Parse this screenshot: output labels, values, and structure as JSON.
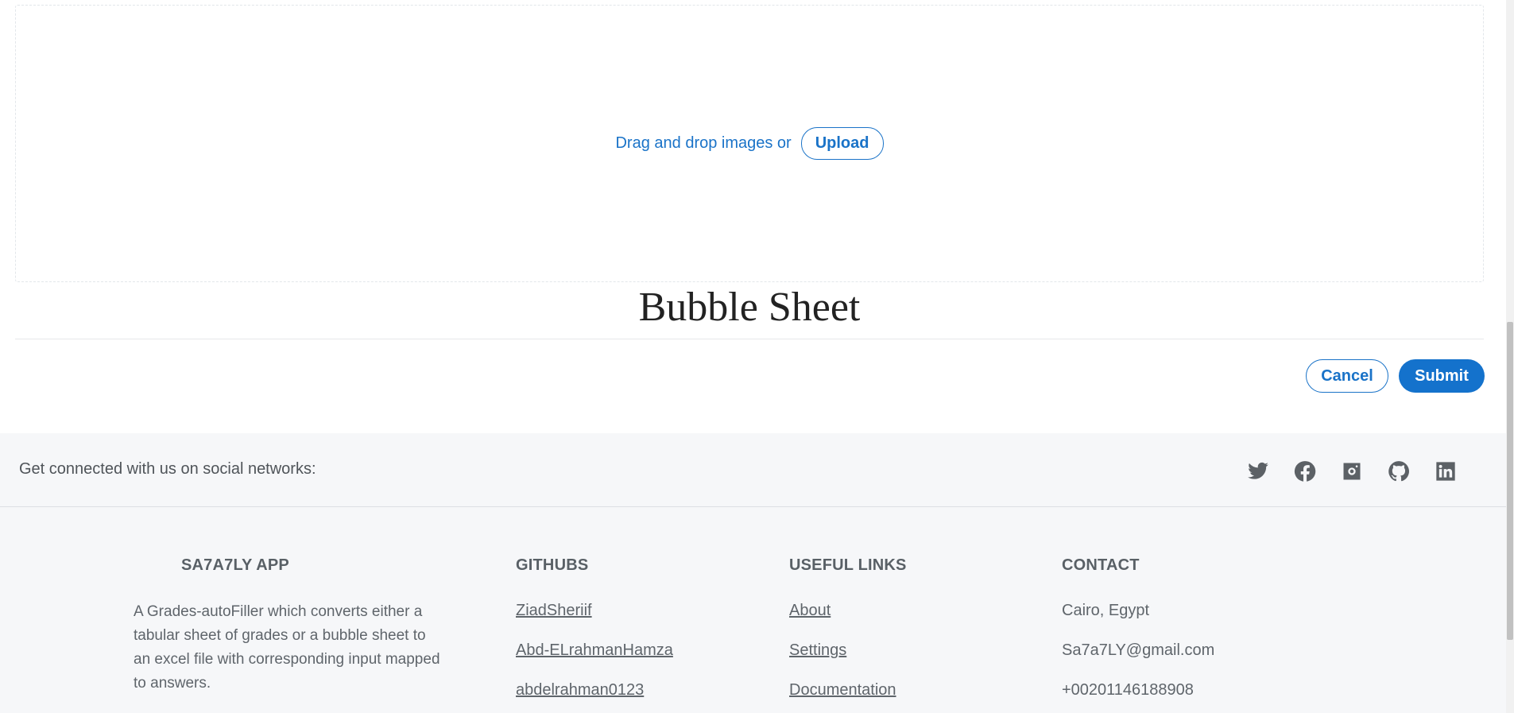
{
  "dropzone": {
    "text": "Drag and drop images or",
    "upload_label": "Upload"
  },
  "sheet": {
    "title": "Bubble Sheet"
  },
  "actions": {
    "cancel_label": "Cancel",
    "submit_label": "Submit"
  },
  "footer": {
    "social_text": "Get connected with us on social networks:",
    "social_icons": [
      "twitter-icon",
      "facebook-icon",
      "instagram-icon",
      "github-icon",
      "linkedin-icon"
    ],
    "app": {
      "heading": "SA7A7LY APP",
      "description": "A Grades-autoFiller which converts either a tabular sheet of grades or a bubble sheet to an excel file with corresponding input mapped to answers."
    },
    "githubs": {
      "heading": "GITHUBS",
      "links": [
        "ZiadSheriif",
        "Abd-ELrahmanHamza",
        "abdelrahman0123"
      ]
    },
    "useful_links": {
      "heading": "USEFUL LINKS",
      "links": [
        "About",
        "Settings",
        "Documentation"
      ]
    },
    "contact": {
      "heading": "CONTACT",
      "items": [
        "Cairo, Egypt",
        "Sa7a7LY@gmail.com",
        "+00201146188908"
      ]
    }
  },
  "colors": {
    "accent": "#1a73c8",
    "footer_bg": "#f6f7f9",
    "text_muted": "#5f656b"
  }
}
